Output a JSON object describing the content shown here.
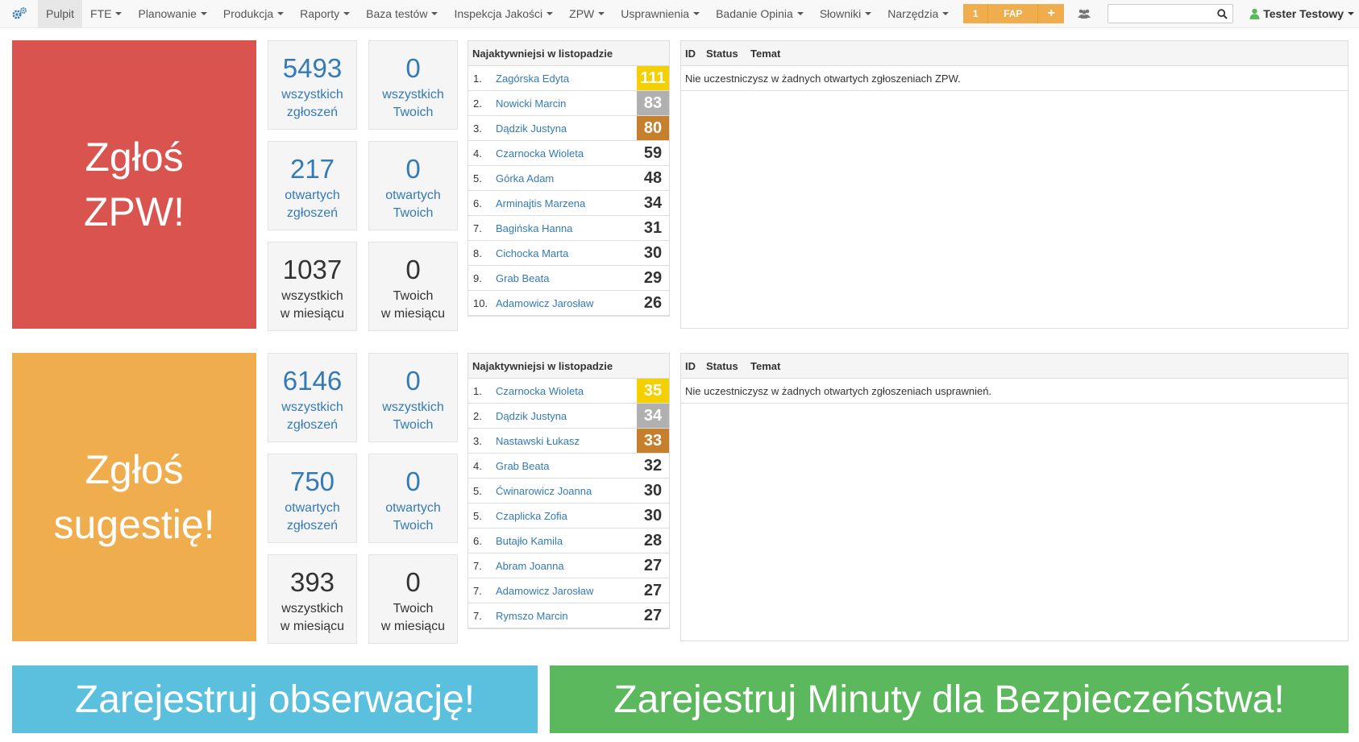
{
  "nav": {
    "items": [
      {
        "label": "Pulpit",
        "dropdown": false,
        "active": true
      },
      {
        "label": "FTE",
        "dropdown": true
      },
      {
        "label": "Planowanie",
        "dropdown": true
      },
      {
        "label": "Produkcja",
        "dropdown": true
      },
      {
        "label": "Raporty",
        "dropdown": true
      },
      {
        "label": "Baza testów",
        "dropdown": true
      },
      {
        "label": "Inspekcja Jakości",
        "dropdown": true
      },
      {
        "label": "ZPW",
        "dropdown": true
      },
      {
        "label": "Usprawnienia",
        "dropdown": true
      },
      {
        "label": "Badanie Opinia",
        "dropdown": true
      },
      {
        "label": "Słowniki",
        "dropdown": true
      },
      {
        "label": "Narzędzia",
        "dropdown": true
      }
    ],
    "fap_count": "1",
    "fap_label": "FAP",
    "fap_plus": "+",
    "search_value": "",
    "user_name": "Tester Testowy"
  },
  "zpw": {
    "tile_line1": "Zgłoś",
    "tile_line2": "ZPW!",
    "stats": [
      {
        "value": "5493",
        "line1": "wszystkich",
        "line2": "zgłoszeń"
      },
      {
        "value": "0",
        "line1": "wszystkich",
        "line2": "Twoich"
      },
      {
        "value": "217",
        "line1": "otwartych",
        "line2": "zgłoszeń"
      },
      {
        "value": "0",
        "line1": "otwartych",
        "line2": "Twoich"
      },
      {
        "value": "1037",
        "line1": "wszystkich",
        "line2": "w miesiącu"
      },
      {
        "value": "0",
        "line1": "Twoich",
        "line2": "w miesiącu"
      }
    ],
    "ranking_title": "Najaktywniejsi w listopadzie",
    "ranking": [
      {
        "pos": "1.",
        "name": "Zagórska Edyta",
        "score": "111"
      },
      {
        "pos": "2.",
        "name": "Nowicki Marcin",
        "score": "83"
      },
      {
        "pos": "3.",
        "name": "Dądzik Justyna",
        "score": "80"
      },
      {
        "pos": "4.",
        "name": "Czarnocka Wioleta",
        "score": "59"
      },
      {
        "pos": "5.",
        "name": "Górka Adam",
        "score": "48"
      },
      {
        "pos": "6.",
        "name": "Arminajtis Marzena",
        "score": "34"
      },
      {
        "pos": "7.",
        "name": "Bagińska Hanna",
        "score": "31"
      },
      {
        "pos": "8.",
        "name": "Cichocka Marta",
        "score": "30"
      },
      {
        "pos": "9.",
        "name": "Grab Beata",
        "score": "29"
      },
      {
        "pos": "10.",
        "name": "Adamowicz Jarosław",
        "score": "26"
      }
    ],
    "issues_cols": [
      "ID",
      "Status",
      "Temat"
    ],
    "issues_empty": "Nie uczestniczysz w żadnych otwartych zgłoszeniach ZPW."
  },
  "sug": {
    "tile_line1": "Zgłoś",
    "tile_line2": "sugestię!",
    "stats": [
      {
        "value": "6146",
        "line1": "wszystkich",
        "line2": "zgłoszeń"
      },
      {
        "value": "0",
        "line1": "wszystkich",
        "line2": "Twoich"
      },
      {
        "value": "750",
        "line1": "otwartych",
        "line2": "zgłoszeń"
      },
      {
        "value": "0",
        "line1": "otwartych",
        "line2": "Twoich"
      },
      {
        "value": "393",
        "line1": "wszystkich",
        "line2": "w miesiącu"
      },
      {
        "value": "0",
        "line1": "Twoich",
        "line2": "w miesiącu"
      }
    ],
    "ranking_title": "Najaktywniejsi w listopadzie",
    "ranking": [
      {
        "pos": "1.",
        "name": "Czarnocka Wioleta",
        "score": "35"
      },
      {
        "pos": "2.",
        "name": "Dądzik Justyna",
        "score": "34"
      },
      {
        "pos": "3.",
        "name": "Nastawski Łukasz",
        "score": "33"
      },
      {
        "pos": "4.",
        "name": "Grab Beata",
        "score": "32"
      },
      {
        "pos": "5.",
        "name": "Ćwinarowicz Joanna",
        "score": "30"
      },
      {
        "pos": "5.",
        "name": "Czaplicka Zofia",
        "score": "30"
      },
      {
        "pos": "6.",
        "name": "Butajło Kamila",
        "score": "28"
      },
      {
        "pos": "7.",
        "name": "Abram Joanna",
        "score": "27"
      },
      {
        "pos": "7.",
        "name": "Adamowicz Jarosław",
        "score": "27"
      },
      {
        "pos": "7.",
        "name": "Rymszo Marcin",
        "score": "27"
      }
    ],
    "issues_cols": [
      "ID",
      "Status",
      "Temat"
    ],
    "issues_empty": "Nie uczestniczysz w żadnych otwartych zgłoszeniach usprawnień."
  },
  "buttons": {
    "observation": "Zarejestruj obserwację!",
    "safety": "Zarejestruj Minuty dla Bezpieczeństwa!"
  },
  "colors": {
    "zpw_tile": "#d9534f",
    "sug_tile": "#f0ad4e",
    "observation_btn": "#5bc0de",
    "safety_btn": "#5cb85c",
    "link": "#337ab7",
    "gold": "#f4d000",
    "silver": "#b0b0b0",
    "bronze": "#c67f2c"
  }
}
